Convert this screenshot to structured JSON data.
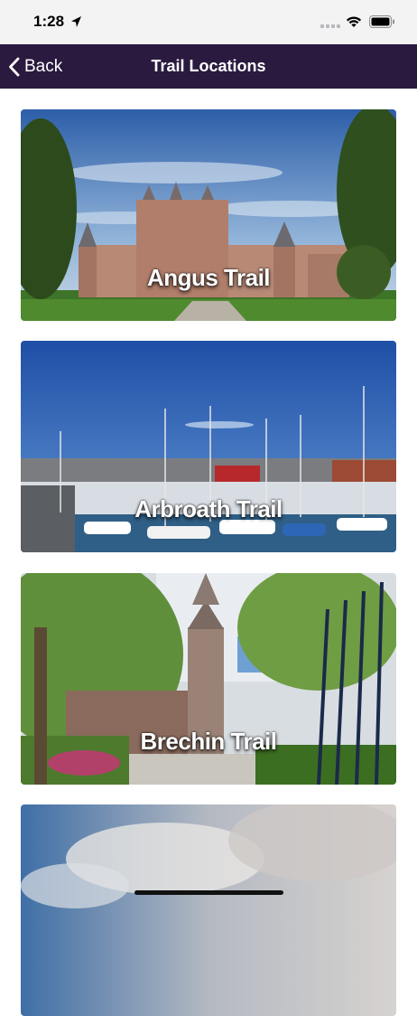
{
  "status_bar": {
    "time": "1:28",
    "icons": [
      "location-arrow-icon",
      "cellular-signal-icon",
      "wifi-icon",
      "battery-icon"
    ]
  },
  "nav": {
    "back_label": "Back",
    "back_icon": "chevron-left-icon",
    "title": "Trail Locations",
    "background_color": "#2a1a3f"
  },
  "trails": [
    {
      "name": "Angus Trail"
    },
    {
      "name": "Arbroath Trail"
    },
    {
      "name": "Brechin Trail"
    },
    {
      "name": ""
    }
  ]
}
